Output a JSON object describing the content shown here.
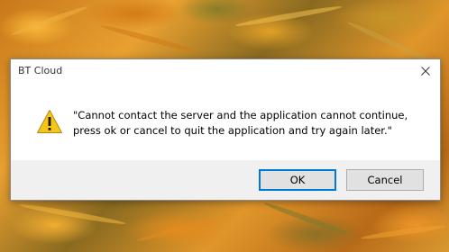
{
  "dialog": {
    "title": "BT Cloud",
    "message": "\"Cannot contact the server and the application cannot continue, press ok or cancel to quit the application and try again later.\"",
    "icon": "warning-icon",
    "close_icon": "close-icon",
    "ok_label": "OK",
    "cancel_label": "Cancel"
  },
  "colors": {
    "accent": "#0078d7",
    "footer": "#f0f0f0",
    "warning": "#f5c518"
  }
}
